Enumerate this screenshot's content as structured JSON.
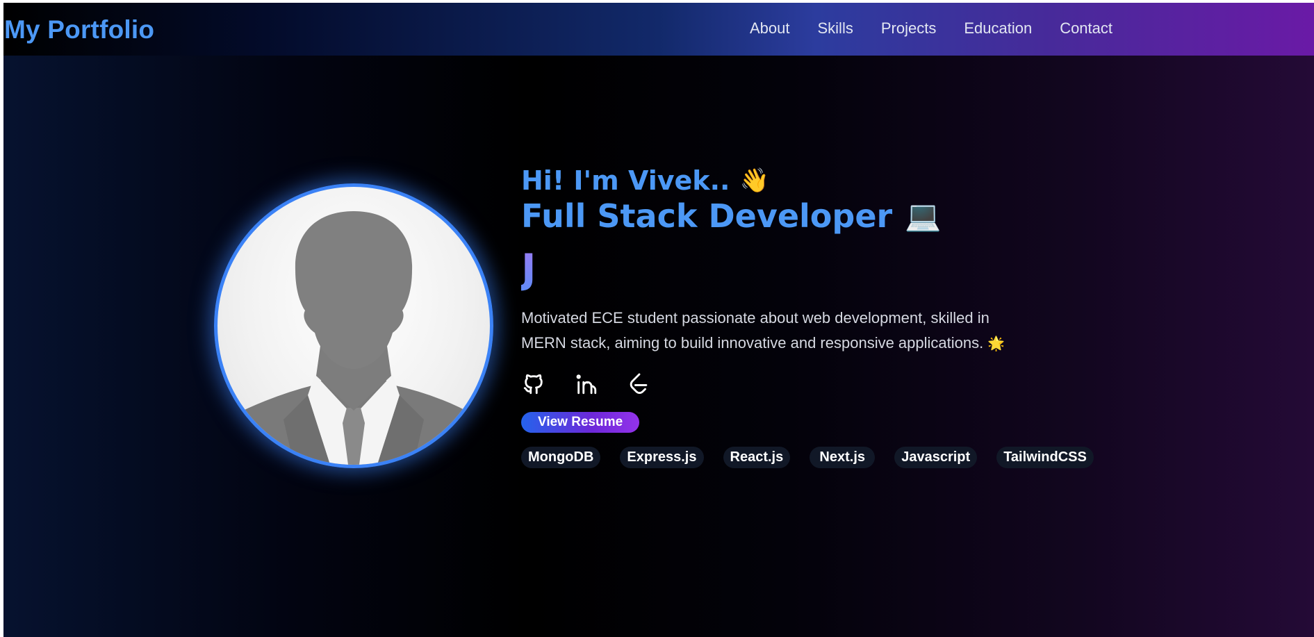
{
  "brand": "My Portfolio",
  "nav": {
    "items": [
      "About",
      "Skills",
      "Projects",
      "Education",
      "Contact"
    ]
  },
  "hero": {
    "greeting": "Hi! I'm Vivek..",
    "greeting_emoji": "👋",
    "role": "Full Stack Developer",
    "role_emoji": "💻",
    "typing_text": "J",
    "bio_line1": "Motivated ECE student passionate about web development, skilled in",
    "bio_line2": "MERN stack, aiming to build innovative and responsive applications.",
    "bio_emoji": "🌟",
    "resume_button": "View Resume",
    "skills": [
      "MongoDB",
      "Express.js",
      "React.js",
      "Next.js",
      "Javascript",
      "TailwindCSS"
    ]
  },
  "socials": [
    {
      "icon": "github-icon"
    },
    {
      "icon": "linkedin-icon"
    },
    {
      "icon": "leetcode-icon"
    }
  ],
  "colors": {
    "accent": "#4c98f5",
    "avatar_border": "#3b82f6",
    "tag_bg": "#111827",
    "button_gradient_start": "#2563eb",
    "button_gradient_end": "#9333ea"
  }
}
